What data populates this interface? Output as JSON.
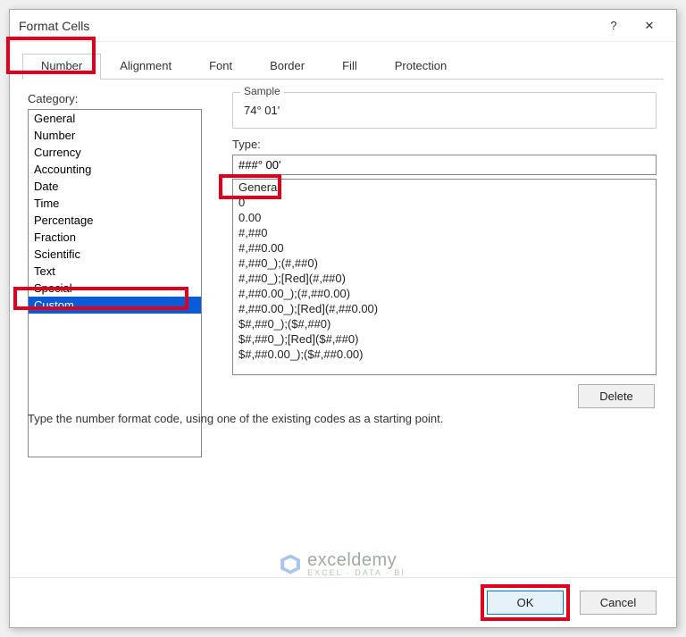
{
  "dialog": {
    "title": "Format Cells",
    "help_symbol": "?",
    "close_symbol": "✕"
  },
  "tabs": {
    "items": [
      {
        "label": "Number",
        "active": true
      },
      {
        "label": "Alignment",
        "active": false
      },
      {
        "label": "Font",
        "active": false
      },
      {
        "label": "Border",
        "active": false
      },
      {
        "label": "Fill",
        "active": false
      },
      {
        "label": "Protection",
        "active": false
      }
    ]
  },
  "category": {
    "label": "Category:",
    "items": [
      {
        "label": "General"
      },
      {
        "label": "Number"
      },
      {
        "label": "Currency"
      },
      {
        "label": "Accounting"
      },
      {
        "label": "Date"
      },
      {
        "label": "Time"
      },
      {
        "label": "Percentage"
      },
      {
        "label": "Fraction"
      },
      {
        "label": "Scientific"
      },
      {
        "label": "Text"
      },
      {
        "label": "Special"
      },
      {
        "label": "Custom",
        "selected": true
      }
    ]
  },
  "sample": {
    "label": "Sample",
    "value": "74° 01'"
  },
  "type": {
    "label": "Type:",
    "value": "###° 00'"
  },
  "formats": {
    "items": [
      "General",
      "0",
      "0.00",
      "#,##0",
      "#,##0.00",
      "#,##0_);(#,##0)",
      "#,##0_);[Red](#,##0)",
      "#,##0.00_);(#,##0.00)",
      "#,##0.00_);[Red](#,##0.00)",
      "$#,##0_);($#,##0)",
      "$#,##0_);[Red]($#,##0)",
      "$#,##0.00_);($#,##0.00)"
    ]
  },
  "buttons": {
    "delete": "Delete",
    "ok": "OK",
    "cancel": "Cancel"
  },
  "hint": "Type the number format code, using one of the existing codes as a starting point.",
  "watermark": {
    "t1": "exceldemy",
    "t2": "EXCEL · DATA · BI"
  }
}
